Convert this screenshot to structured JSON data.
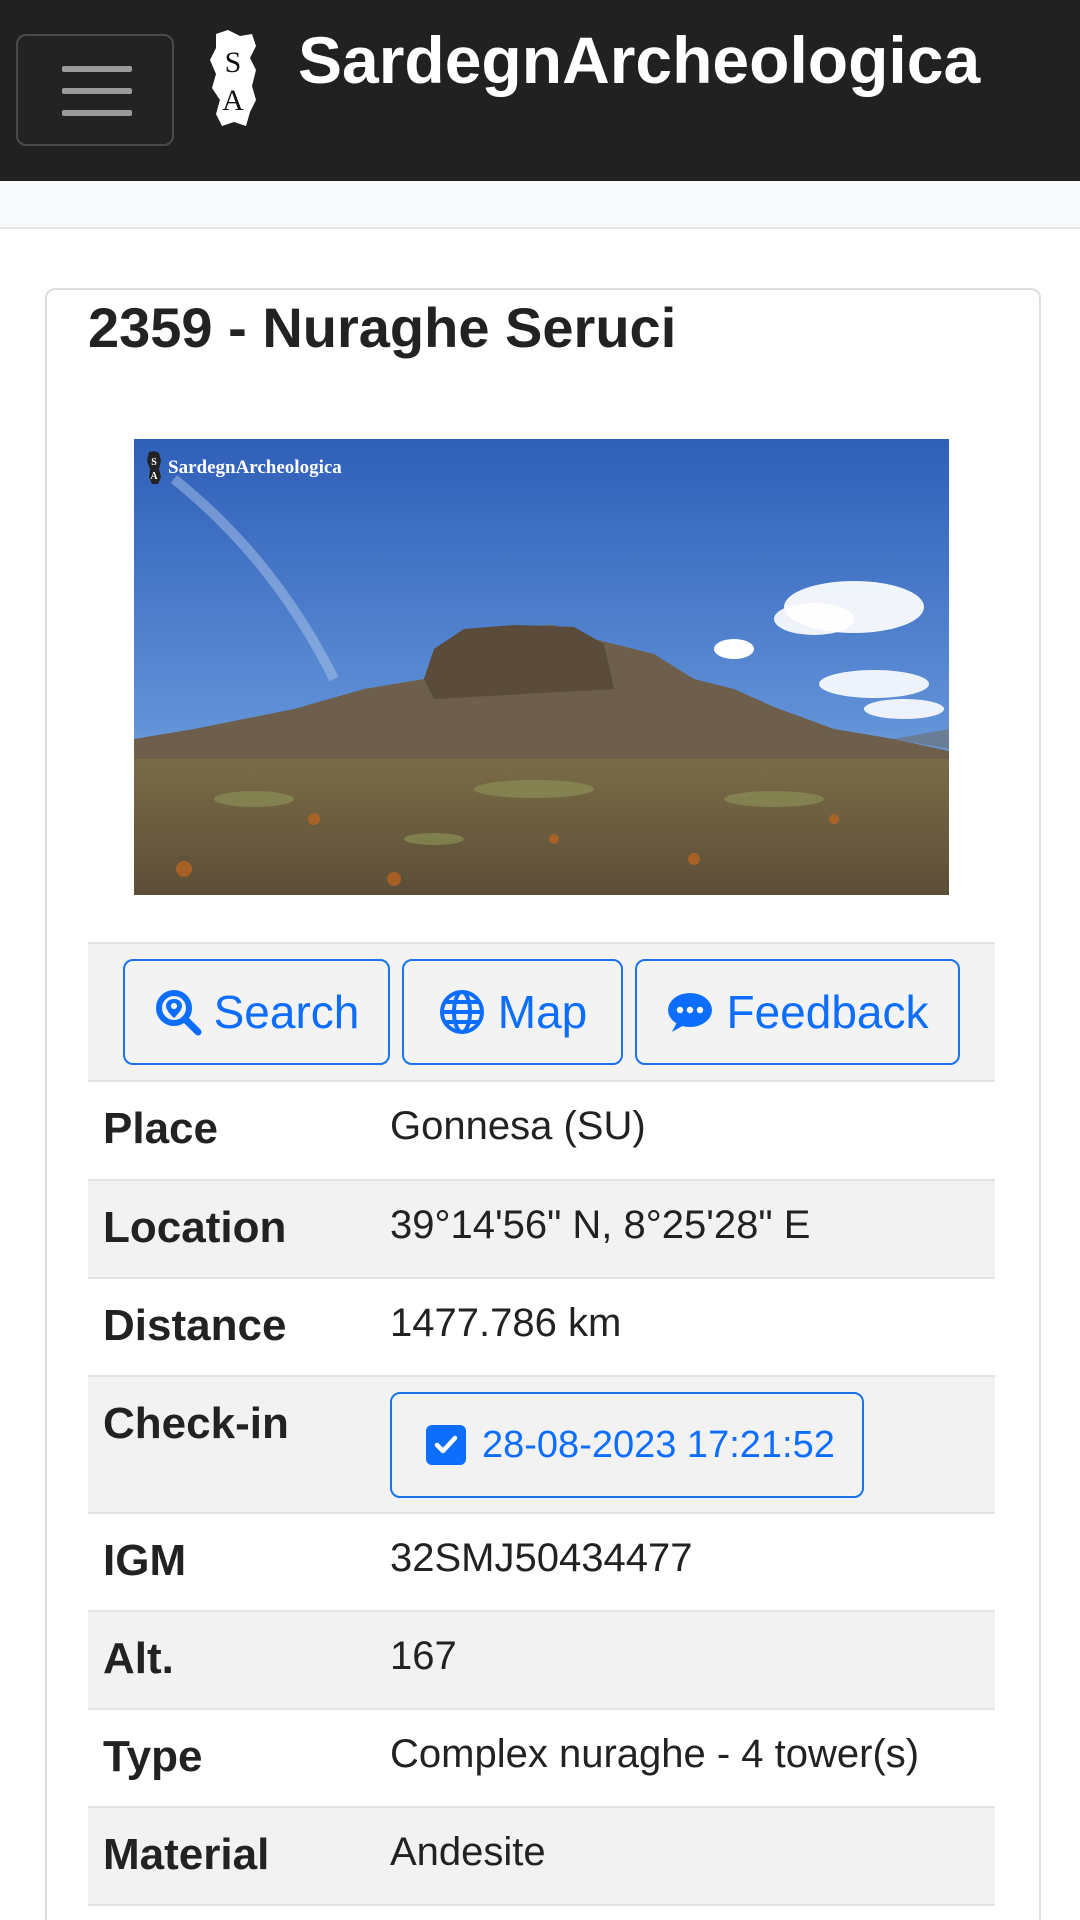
{
  "navbar": {
    "brand": "SardegnArcheologica",
    "logo_text": "SA"
  },
  "site": {
    "title": "2359 - Nuraghe Seruci",
    "image_watermark": "SardegnArcheologica"
  },
  "actions": {
    "search": "Search",
    "map": "Map",
    "feedback": "Feedback"
  },
  "details": {
    "place_label": "Place",
    "place": "Gonnesa (SU)",
    "location_label": "Location",
    "location": "39°14'56\" N, 8°25'28\" E",
    "distance_label": "Distance",
    "distance": "1477.786 km",
    "checkin_label": "Check-in",
    "checkin": "28-08-2023 17:21:52",
    "igm_label": "IGM",
    "igm": "32SMJ50434477",
    "alt_label": "Alt.",
    "alt": "167",
    "type_label": "Type",
    "type": "Complex nuraghe - 4 tower(s)",
    "material_label": "Material",
    "material": "Andesite"
  },
  "colors": {
    "navbar": "#212121",
    "accent": "#0d6efd",
    "row_stripe": "#f2f2f2"
  },
  "icons": [
    "menu-icon",
    "sardinia-logo-icon",
    "search-location-icon",
    "globe-icon",
    "comment-dots-icon",
    "checkbox-checked-icon"
  ]
}
